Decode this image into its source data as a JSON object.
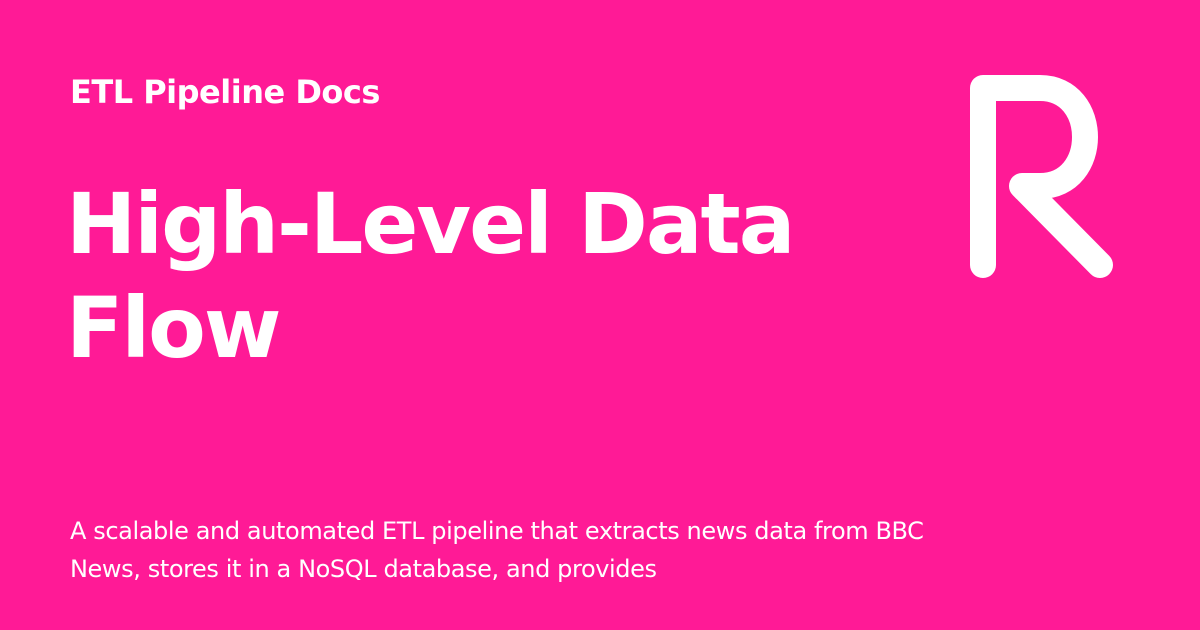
{
  "theme": {
    "background": "#ff1a96",
    "text_color": "#ffffff"
  },
  "header": {
    "site_name": "ETL Pipeline Docs",
    "logo_icon": "letter-r-logo-icon"
  },
  "main": {
    "title": "High-Level Data Flow",
    "description": "A scalable and automated ETL pipeline that extracts news data from BBC News, stores it in a NoSQL database, and provides"
  }
}
